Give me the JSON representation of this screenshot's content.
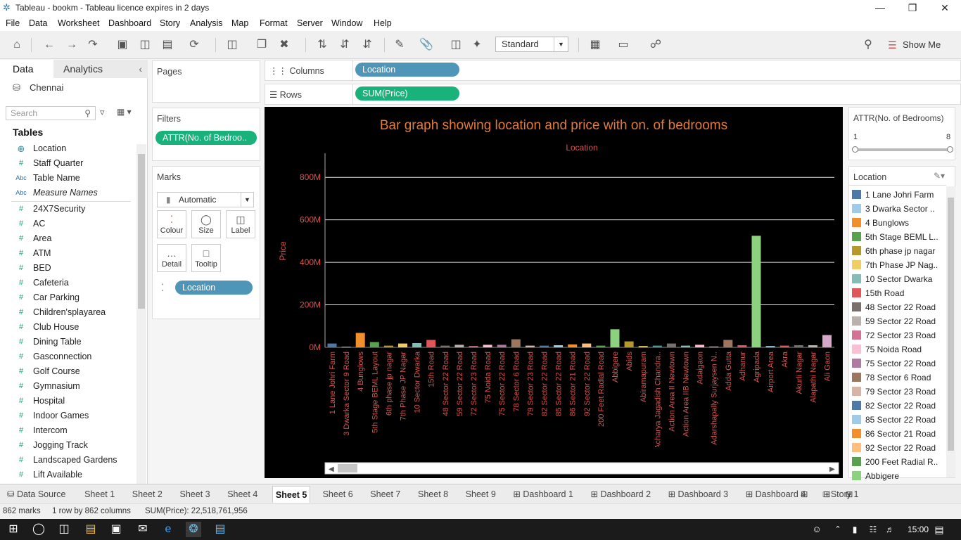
{
  "window": {
    "title": "Tableau - bookm - Tableau licence expires in 2 days"
  },
  "menu": [
    "File",
    "Data",
    "Worksheet",
    "Dashboard",
    "Story",
    "Analysis",
    "Map",
    "Format",
    "Server",
    "Window",
    "Help"
  ],
  "toolbar": {
    "standard": "Standard",
    "show_me": "Show Me"
  },
  "left": {
    "tab_data": "Data",
    "tab_analytics": "Analytics",
    "datasource": "Chennai",
    "search_placeholder": "Search",
    "tables_heading": "Tables",
    "fields": [
      {
        "icon": "globe",
        "name": "Location"
      },
      {
        "icon": "#",
        "name": "Staff Quarter"
      },
      {
        "icon": "Abc",
        "name": "Table Name"
      },
      {
        "icon": "Abc",
        "name": "Measure Names"
      },
      {
        "icon": "#",
        "name": "24X7Security"
      },
      {
        "icon": "#",
        "name": "AC"
      },
      {
        "icon": "#",
        "name": "Area"
      },
      {
        "icon": "#",
        "name": "ATM"
      },
      {
        "icon": "#",
        "name": "BED"
      },
      {
        "icon": "#",
        "name": "Cafeteria"
      },
      {
        "icon": "#",
        "name": "Car Parking"
      },
      {
        "icon": "#",
        "name": "Children'splayarea"
      },
      {
        "icon": "#",
        "name": "Club House"
      },
      {
        "icon": "#",
        "name": "Dining Table"
      },
      {
        "icon": "#",
        "name": "Gasconnection"
      },
      {
        "icon": "#",
        "name": "Golf Course"
      },
      {
        "icon": "#",
        "name": "Gymnasium"
      },
      {
        "icon": "#",
        "name": "Hospital"
      },
      {
        "icon": "#",
        "name": "Indoor Games"
      },
      {
        "icon": "#",
        "name": "Intercom"
      },
      {
        "icon": "#",
        "name": "Jogging Track"
      },
      {
        "icon": "#",
        "name": "Landscaped Gardens"
      },
      {
        "icon": "#",
        "name": "Lift Available"
      }
    ]
  },
  "cards": {
    "pages": "Pages",
    "filters": "Filters",
    "filter_pill": "ATTR(No. of Bedroo..",
    "marks": "Marks",
    "mark_type": "Automatic",
    "mark_buttons": [
      "Colour",
      "Size",
      "Label",
      "Detail",
      "Tooltip"
    ],
    "marks_pill": "Location"
  },
  "shelves": {
    "columns_label": "Columns",
    "columns_pill": "Location",
    "rows_label": "Rows",
    "rows_pill": "SUM(Price)"
  },
  "right": {
    "filter_title": "ATTR(No. of Bedrooms)",
    "range_min": "1",
    "range_max": "8",
    "legend_title": "Location",
    "legend": [
      {
        "name": "1 Lane Johri Farm",
        "color": "#4e79a7"
      },
      {
        "name": "3 Dwarka Sector ..",
        "color": "#a0cbe8"
      },
      {
        "name": "4 Bunglows",
        "color": "#f28e2b"
      },
      {
        "name": "5th Stage BEML L..",
        "color": "#59a14f"
      },
      {
        "name": "6th phase jp nagar",
        "color": "#b6992d"
      },
      {
        "name": "7th Phase JP Nag..",
        "color": "#f1ce63"
      },
      {
        "name": "10 Sector Dwarka",
        "color": "#86bcb6"
      },
      {
        "name": "15th Road",
        "color": "#e15759"
      },
      {
        "name": "48 Sector 22 Road",
        "color": "#79706e"
      },
      {
        "name": "59 Sector 22 Road",
        "color": "#bab0ac"
      },
      {
        "name": "72 Sector 23 Road",
        "color": "#d37295"
      },
      {
        "name": "75 Noida Road",
        "color": "#fabfd2"
      },
      {
        "name": "75 Sector 22 Road",
        "color": "#b07aa1"
      },
      {
        "name": "78 Sector 6 Road",
        "color": "#9d7660"
      },
      {
        "name": "79 Sector 23 Road",
        "color": "#d7b5a6"
      },
      {
        "name": "82 Sector 22 Road",
        "color": "#4e79a7"
      },
      {
        "name": "85 Sector 22 Road",
        "color": "#a0cbe8"
      },
      {
        "name": "86 Sector 21 Road",
        "color": "#f28e2b"
      },
      {
        "name": "92 Sector 22 Road",
        "color": "#ffbe7d"
      },
      {
        "name": "200 Feet Radial R..",
        "color": "#59a14f"
      },
      {
        "name": "Abbigere",
        "color": "#8cd17d"
      }
    ]
  },
  "chart_data": {
    "type": "bar",
    "title": "Bar graph showing location and price with on. of bedrooms",
    "xlabel": "Location",
    "ylabel": "Price",
    "ylim": [
      0,
      900
    ],
    "y_ticks": [
      "0M",
      "200M",
      "400M",
      "600M",
      "800M"
    ],
    "y_tick_values": [
      0,
      200,
      400,
      600,
      800
    ],
    "categories": [
      "1 Lane Johri Farm",
      "3 Dwarka Sector 9 Road",
      "4 Bunglows",
      "5th Stage BEML Layout",
      "6th phase jp nagar",
      "7th Phase JP Nagar",
      "10 Sector Dwarka",
      "15th Road",
      "48 Sector 22 Road",
      "59 Sector 22 Road",
      "72 Sector 23 Road",
      "75 Noida Road",
      "75 Sector 22 Road",
      "78 Sector 6 Road",
      "79 Sector 23 Road",
      "82 Sector 22 Road",
      "85 Sector 22 Road",
      "86 Sector 21 Road",
      "92 Sector 22 Road",
      "200 Feet Radial Road",
      "Abbigere",
      "Abids",
      "Abiramapuram",
      "Acharya Jagadish Chandra..",
      "Action Area II Newtown",
      "Action Area IIB Newtown",
      "Adaigaon",
      "Adarshapally Surjaysen N..",
      "Adda Gutta",
      "Adhanur",
      "Agripada",
      "Airport Area",
      "Akra",
      "Akurli Nagar",
      "Alapathi Nagar",
      "Ali Gaon"
    ],
    "values": [
      18,
      3,
      68,
      25,
      8,
      18,
      20,
      35,
      8,
      12,
      6,
      12,
      12,
      38,
      8,
      8,
      10,
      14,
      18,
      8,
      85,
      28,
      6,
      8,
      18,
      8,
      12,
      4,
      35,
      10,
      525,
      6,
      8,
      10,
      10,
      58
    ],
    "colors": [
      "#4e79a7",
      "#a0cbe8",
      "#f28e2b",
      "#59a14f",
      "#b6992d",
      "#f1ce63",
      "#86bcb6",
      "#e15759",
      "#79706e",
      "#bab0ac",
      "#d37295",
      "#fabfd2",
      "#b07aa1",
      "#9d7660",
      "#d7b5a6",
      "#4e79a7",
      "#a0cbe8",
      "#f28e2b",
      "#ffbe7d",
      "#59a14f",
      "#8cd17d",
      "#b6992d",
      "#f1ce63",
      "#499894",
      "#79706e",
      "#86bcb6",
      "#fabfd2",
      "#d4a6c8",
      "#9d7660",
      "#e15759",
      "#8cd17d",
      "#a0cbe8",
      "#e15759",
      "#79706e",
      "#bab0ac",
      "#d4a6c8"
    ]
  },
  "sheet_tabs": [
    "Data Source",
    "Sheet 1",
    "Sheet 2",
    "Sheet 3",
    "Sheet 4",
    "Sheet 5",
    "Sheet 6",
    "Sheet 7",
    "Sheet 8",
    "Sheet 9",
    "Dashboard 1",
    "Dashboard 2",
    "Dashboard 3",
    "Dashboard 4",
    "Story 1"
  ],
  "active_tab": "Sheet 5",
  "status": {
    "marks": "862 marks",
    "dims": "1 row by 862 columns",
    "sum": "SUM(Price): 22,518,761,956"
  },
  "taskbar": {
    "time": "15:00"
  }
}
